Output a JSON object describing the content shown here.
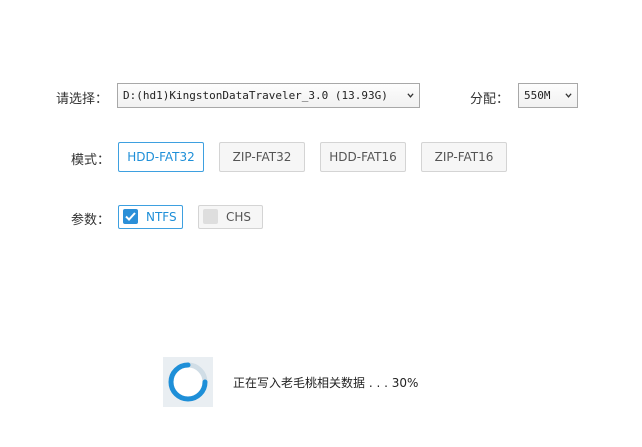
{
  "select_row": {
    "label": "请选择：",
    "drive_value": "D:(hd1)KingstonDataTraveler_3.0 (13.93G)",
    "alloc_label": "分配：",
    "alloc_value": "550M"
  },
  "mode_row": {
    "label": "模式：",
    "options": [
      "HDD-FAT32",
      "ZIP-FAT32",
      "HDD-FAT16",
      "ZIP-FAT16"
    ],
    "selected": "HDD-FAT32"
  },
  "params_row": {
    "label": "参数：",
    "ntfs": {
      "label": "NTFS",
      "checked": true
    },
    "chs": {
      "label": "CHS",
      "checked": false
    }
  },
  "progress": {
    "status_text": "正在写入老毛桃相关数据 . . . 30%",
    "percent": 30
  },
  "colors": {
    "accent": "#1e8fd8",
    "accent_border": "#3ea0e0"
  },
  "icons": {
    "dropdown": "chevron-down-icon",
    "check": "checkmark-icon",
    "loading": "loading-spinner-icon"
  }
}
